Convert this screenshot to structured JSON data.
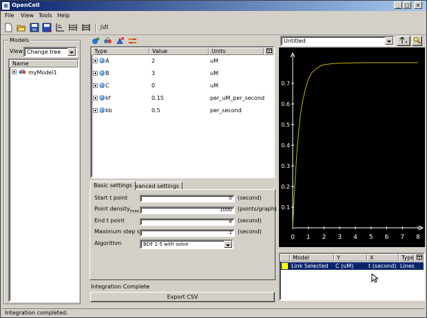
{
  "window": {
    "title": "OpenCell"
  },
  "menu": [
    "File",
    "View",
    "Tools",
    "Help"
  ],
  "toolbar": {
    "integral_label": "∫dt"
  },
  "models_panel": {
    "title": "Models",
    "view_label": "View",
    "view_value": "Change tree",
    "column_name": "Name",
    "items": [
      "myModel1"
    ]
  },
  "variables_table": {
    "columns": [
      "Type",
      "Value",
      "Units"
    ],
    "rows": [
      {
        "name": "A",
        "value": "2",
        "units": "uM"
      },
      {
        "name": "B",
        "value": "3",
        "units": "uM"
      },
      {
        "name": "C",
        "value": "0",
        "units": "uM"
      },
      {
        "name": "kf",
        "value": "0.15",
        "units": "per_uM_per_second"
      },
      {
        "name": "kb",
        "value": "0.5",
        "units": "per_second"
      }
    ]
  },
  "settings": {
    "tabs": [
      "Basic settings",
      "Advanced settings"
    ],
    "fields": [
      {
        "label": "Start t point",
        "value": "0",
        "unit": "(second)"
      },
      {
        "label": "Point density",
        "label_sub": "max",
        "value": "1000",
        "unit": "(points/graph)"
      },
      {
        "label": "End t point",
        "value": "8",
        "unit": "(second)"
      },
      {
        "label": "Maximum step size",
        "value": "1",
        "unit": "(second)"
      }
    ],
    "algorithm_label": "Algorithm",
    "algorithm_value": "BDF 1-5 with solve"
  },
  "integration_status": "Integration Complete",
  "export_button": "Export CSV",
  "status_bar": "Integration completed.",
  "graph": {
    "title_combo": "Untitled",
    "y_ticks": [
      "0.1",
      "0.2",
      "0.3",
      "0.4",
      "0.5",
      "0.6",
      "0.7"
    ],
    "x_ticks": [
      "0",
      "1",
      "2",
      "3",
      "4",
      "5",
      "6",
      "7",
      "8"
    ]
  },
  "chart_data": {
    "type": "line",
    "series": [
      {
        "x": [
          0,
          0.1,
          0.2,
          0.3,
          0.4,
          0.5,
          0.6,
          0.8,
          1.0,
          1.2,
          1.5,
          1.8,
          2.0,
          2.5,
          3.0,
          3.5,
          4.0,
          5.0,
          6.0,
          7.0,
          8.0
        ],
        "values": [
          0,
          0.16,
          0.29,
          0.4,
          0.48,
          0.55,
          0.6,
          0.67,
          0.72,
          0.75,
          0.77,
          0.785,
          0.79,
          0.795,
          0.797,
          0.798,
          0.799,
          0.8,
          0.8,
          0.8,
          0.8
        ],
        "color": "#c8b400"
      }
    ],
    "xlim": [
      0,
      8
    ],
    "ylim": [
      0,
      0.8
    ],
    "colors": {
      "background": "#000000",
      "axes": "#ffffff"
    }
  },
  "links_table": {
    "columns": [
      "Model",
      "Y",
      "X",
      "Type"
    ],
    "rows": [
      {
        "model": "Link Selected",
        "y": "C (uM)",
        "x": "t (second)",
        "type": "Lines",
        "swatch": "#ffff00"
      }
    ]
  }
}
